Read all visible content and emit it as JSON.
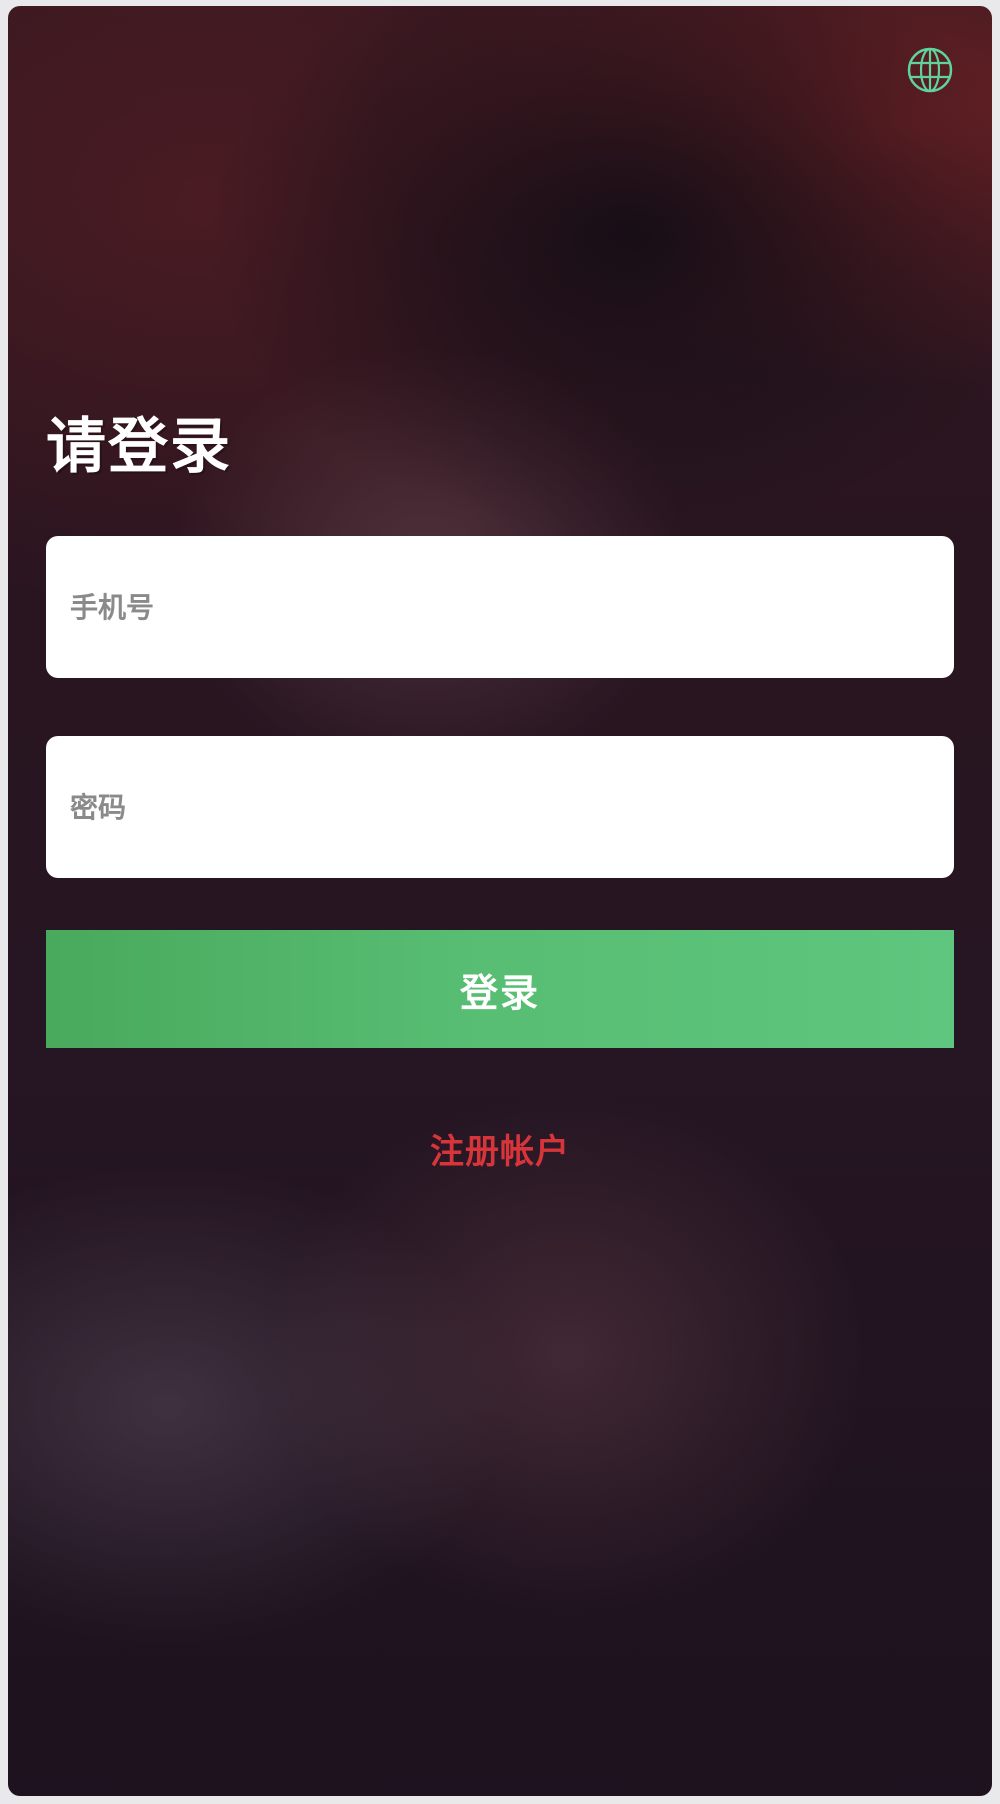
{
  "header": {
    "language_icon": "globe-icon",
    "accent_color": "#5fd39a"
  },
  "login": {
    "title": "请登录",
    "phone_placeholder": "手机号",
    "password_placeholder": "密码",
    "login_label": "登录",
    "register_label": "注册帐户"
  },
  "colors": {
    "login_button": "#57bd72",
    "register_link": "#d8353a",
    "title": "#ffffff"
  }
}
